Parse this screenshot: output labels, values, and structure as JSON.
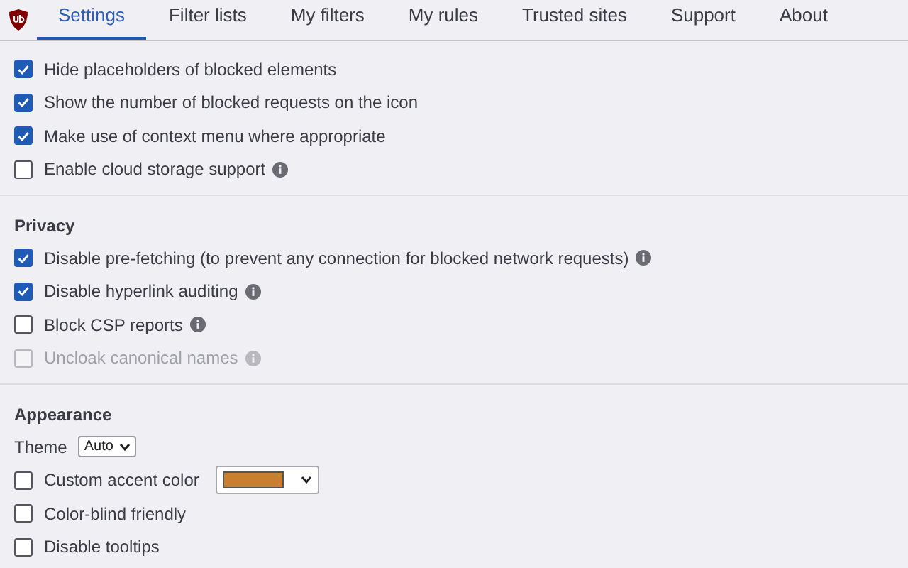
{
  "tabs": [
    {
      "label": "Settings",
      "selected": true
    },
    {
      "label": "Filter lists",
      "selected": false
    },
    {
      "label": "My filters",
      "selected": false
    },
    {
      "label": "My rules",
      "selected": false
    },
    {
      "label": "Trusted sites",
      "selected": false
    },
    {
      "label": "Support",
      "selected": false
    },
    {
      "label": "About",
      "selected": false
    }
  ],
  "sections": [
    {
      "rows": [
        {
          "kind": "checkbox",
          "label": "Hide placeholders of blocked elements",
          "checked": true,
          "disabled": false,
          "info": false
        },
        {
          "kind": "checkbox",
          "label": "Show the number of blocked requests on the icon",
          "checked": true,
          "disabled": false,
          "info": false
        },
        {
          "kind": "checkbox",
          "label": "Make use of context menu where appropriate",
          "checked": true,
          "disabled": false,
          "info": false
        },
        {
          "kind": "checkbox",
          "label": "Enable cloud storage support",
          "checked": false,
          "disabled": false,
          "info": true
        }
      ]
    },
    {
      "heading": "Privacy",
      "rows": [
        {
          "kind": "checkbox",
          "label": "Disable pre-fetching (to prevent any connection for blocked network requests)",
          "checked": true,
          "disabled": false,
          "info": true
        },
        {
          "kind": "checkbox",
          "label": "Disable hyperlink auditing",
          "checked": true,
          "disabled": false,
          "info": true
        },
        {
          "kind": "checkbox",
          "label": "Block CSP reports",
          "checked": false,
          "disabled": false,
          "info": true
        },
        {
          "kind": "checkbox",
          "label": "Uncloak canonical names",
          "checked": false,
          "disabled": true,
          "info": true
        }
      ]
    },
    {
      "heading": "Appearance",
      "rows": [
        {
          "kind": "select",
          "label": "Theme",
          "value": "Auto"
        },
        {
          "kind": "color",
          "label": "Custom accent color",
          "checked": false,
          "disabled": false,
          "color": "#c88030"
        },
        {
          "kind": "checkbox",
          "label": "Color-blind friendly",
          "checked": false,
          "disabled": false,
          "info": false
        },
        {
          "kind": "checkbox",
          "label": "Disable tooltips",
          "checked": false,
          "disabled": false,
          "info": false
        }
      ]
    }
  ]
}
